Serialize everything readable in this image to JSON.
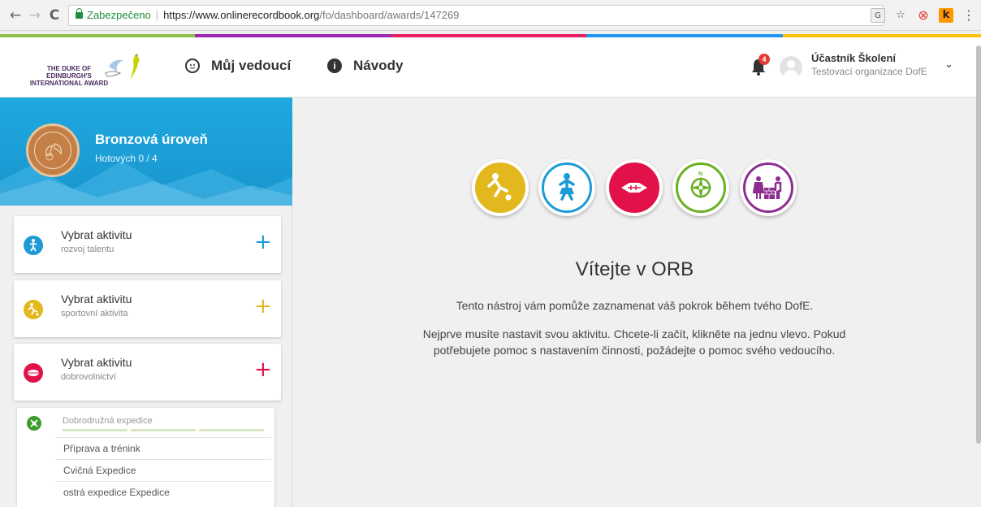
{
  "browser": {
    "secure_label": "Zabezpečeno",
    "url_host": "https://www.onlinerecordbook.org",
    "url_path": "/fo/dashboard/awards/147269",
    "back_glyph": "←",
    "forward_glyph": "→",
    "reload_glyph": "C",
    "translate_glyph": "G",
    "star_glyph": "☆",
    "ext_red_glyph": "⊗",
    "ext_k_glyph": "k",
    "menu_glyph": "⋮"
  },
  "stripe_colors": [
    "#8bc34a",
    "#9c27b0",
    "#e91e63",
    "#2196f3",
    "#ffc107"
  ],
  "header": {
    "logo_text_line1": "THE DUKE OF EDINBURGH'S",
    "logo_text_line2": "INTERNATIONAL AWARD",
    "nav_leader": "Můj vedoucí",
    "nav_guides": "Návody",
    "notification_count": "4",
    "user_name": "Účastník Školení",
    "user_org": "Testovací organizace DofE",
    "chevron_glyph": "⌄"
  },
  "level": {
    "title": "Bronzová úroveň",
    "progress": "Hotových 0 / 4"
  },
  "activities": [
    {
      "title": "Vybrat aktivitu",
      "subtitle": "rozvoj talentu",
      "color": "#1e9ad6",
      "icon": "talent-icon"
    },
    {
      "title": "Vybrat aktivitu",
      "subtitle": "sportovní aktivita",
      "color": "#e3b81f",
      "icon": "sport-icon"
    },
    {
      "title": "Vybrat aktivitu",
      "subtitle": "dobrovolnictví",
      "color": "#e2114a",
      "icon": "volunteer-icon"
    }
  ],
  "plus_glyph": "+",
  "expedition": {
    "title": "Dobrodružná expedice",
    "rows": [
      "Příprava a trénink",
      "Cvičná Expedice",
      "ostrá expedice Expedice"
    ]
  },
  "main": {
    "welcome": "Vítejte v ORB",
    "intro": "Tento nástroj vám pomůže zaznamenat váš pokrok během tvého DofE.",
    "instructions": "Nejprve musíte nastavit svou aktivitu. Chcete-li začít, klikněte na jednu vlevo. Pokud potřebujete pomoc s nastavením činnosti, požádejte o pomoc svého vedoucího."
  },
  "categories": [
    {
      "name": "sport-icon",
      "color": "#e3b81f"
    },
    {
      "name": "talent-icon",
      "color": "#1e9ad6"
    },
    {
      "name": "volunteer-icon",
      "color": "#e2114a"
    },
    {
      "name": "expedition-icon",
      "color": "#6ab023"
    },
    {
      "name": "residential-icon",
      "color": "#8e2d91"
    }
  ]
}
